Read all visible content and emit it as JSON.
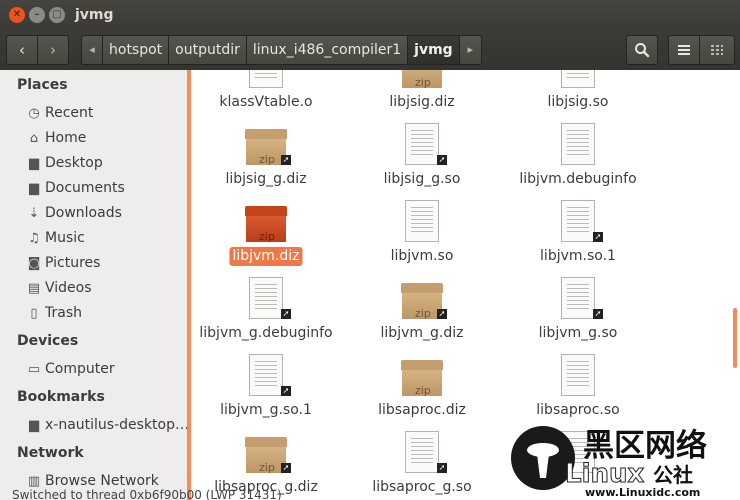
{
  "window": {
    "title": "jvmg"
  },
  "toolbar": {
    "back_glyph": "‹",
    "forward_glyph": "›",
    "crumb_left_glyph": "◂",
    "crumb_right_glyph": "▸",
    "breadcrumbs": [
      "hotspot",
      "outputdir",
      "linux_i486_compiler1",
      "jvmg"
    ],
    "search_icon": "search-icon",
    "list_icon": "list-view-icon",
    "grid_icon": "grid-view-icon"
  },
  "sidebar": {
    "places_heading": "Places",
    "places": [
      {
        "label": "Recent",
        "icon": "clock-icon",
        "glyph": "◷"
      },
      {
        "label": "Home",
        "icon": "home-icon",
        "glyph": "⌂"
      },
      {
        "label": "Desktop",
        "icon": "folder-icon",
        "glyph": "▆"
      },
      {
        "label": "Documents",
        "icon": "documents-icon",
        "glyph": "▆"
      },
      {
        "label": "Downloads",
        "icon": "download-icon",
        "glyph": "⇣"
      },
      {
        "label": "Music",
        "icon": "music-icon",
        "glyph": "♫"
      },
      {
        "label": "Pictures",
        "icon": "camera-icon",
        "glyph": "◙"
      },
      {
        "label": "Videos",
        "icon": "film-icon",
        "glyph": "▤"
      },
      {
        "label": "Trash",
        "icon": "trash-icon",
        "glyph": "▯"
      }
    ],
    "devices_heading": "Devices",
    "devices": [
      {
        "label": "Computer",
        "icon": "computer-icon",
        "glyph": "▭"
      }
    ],
    "bookmarks_heading": "Bookmarks",
    "bookmarks": [
      {
        "label": "x-nautilus-desktop…",
        "icon": "folder-icon",
        "glyph": "▆"
      }
    ],
    "network_heading": "Network",
    "network": [
      {
        "label": "Browse Network",
        "icon": "network-icon",
        "glyph": "▥"
      }
    ]
  },
  "files": [
    {
      "name": "klassVtable.o",
      "type": "doc",
      "link": false
    },
    {
      "name": "libjsig.diz",
      "type": "zip",
      "link": false
    },
    {
      "name": "libjsig.so",
      "type": "doc",
      "link": false
    },
    {
      "name": "libjsig_g.diz",
      "type": "zip",
      "link": true
    },
    {
      "name": "libjsig_g.so",
      "type": "doc",
      "link": true
    },
    {
      "name": "libjvm.debuginfo",
      "type": "doc",
      "link": false
    },
    {
      "name": "libjvm.diz",
      "type": "zip-selected",
      "link": false
    },
    {
      "name": "libjvm.so",
      "type": "doc",
      "link": false
    },
    {
      "name": "libjvm.so.1",
      "type": "doc",
      "link": true
    },
    {
      "name": "libjvm_g.debuginfo",
      "type": "doc",
      "link": true
    },
    {
      "name": "libjvm_g.diz",
      "type": "zip",
      "link": true
    },
    {
      "name": "libjvm_g.so",
      "type": "doc",
      "link": true
    },
    {
      "name": "libjvm_g.so.1",
      "type": "doc",
      "link": true
    },
    {
      "name": "libsaproc.diz",
      "type": "zip",
      "link": false
    },
    {
      "name": "libsaproc.so",
      "type": "doc",
      "link": false
    },
    {
      "name": "libsaproc_g.diz",
      "type": "zip",
      "link": true
    },
    {
      "name": "libsaproc_g.so",
      "type": "doc",
      "link": true
    },
    {
      "name": "",
      "type": "doc",
      "link": false
    }
  ],
  "zip_tag": "zip",
  "link_glyph": "➚",
  "status": "Switched to thread 0xb6f90b00 (LWP 31431)",
  "watermark": {
    "line1": "黑区网络",
    "brand": "Linux",
    "suffix": "公社",
    "url": "www.Linuxidc.com"
  },
  "colors": {
    "accent": "#f07746",
    "titlebar": "#3c3b37",
    "close": "#e95420"
  }
}
